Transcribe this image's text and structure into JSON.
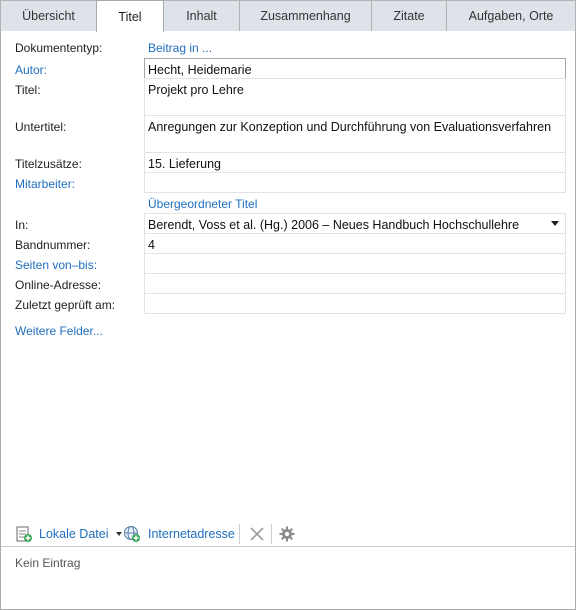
{
  "tabs": [
    {
      "label": "Übersicht",
      "active": false
    },
    {
      "label": "Titel",
      "active": true
    },
    {
      "label": "Inhalt",
      "active": false
    },
    {
      "label": "Zusammenhang",
      "active": false
    },
    {
      "label": "Zitate",
      "active": false
    },
    {
      "label": "Aufgaben, Orte",
      "active": false
    }
  ],
  "form": {
    "doc_type_label": "Dokumententyp:",
    "doc_type_value": "Beitrag in ...",
    "author_label": "Autor:",
    "author_value": "Hecht, Heidemarie",
    "title_label": "Titel:",
    "title_value": "Projekt pro Lehre",
    "subtitle_label": "Untertitel:",
    "subtitle_value": "Anregungen zur Konzeption und Durchführung von Evaluationsverfahren",
    "title_additions_label": "Titelzusätze:",
    "title_additions_value": "15. Lieferung",
    "contributors_label": "Mitarbeiter:",
    "contributors_value": "",
    "parent_heading": "Übergeordneter Titel",
    "in_label": "In:",
    "in_value": "Berendt, Voss et al. (Hg.) 2006 – Neues Handbuch Hochschullehre",
    "volume_label": "Bandnummer:",
    "volume_value": "4",
    "pages_label": "Seiten von–bis:",
    "pages_value": "",
    "online_label": "Online-Adresse:",
    "online_value": "",
    "checked_label": "Zuletzt geprüft am:",
    "checked_value": "",
    "more_fields": "Weitere Felder..."
  },
  "toolbar": {
    "local_file": "Lokale Datei",
    "internet_address": "Internetadresse"
  },
  "status": "Kein Eintrag",
  "colors": {
    "link": "#1f6fbf",
    "tab_inactive": "#dee3ea"
  }
}
